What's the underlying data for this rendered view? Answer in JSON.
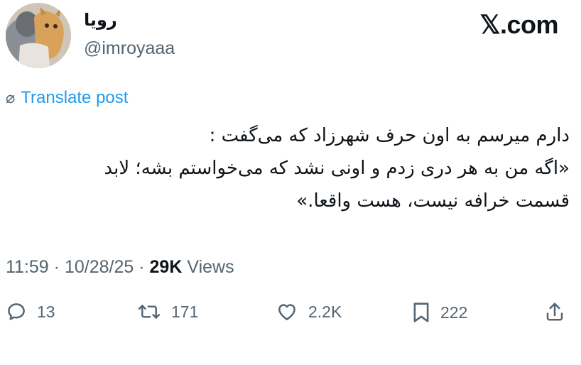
{
  "user": {
    "display_name": "رویا",
    "handle": "@imroyaaa"
  },
  "brand": "𝕏.com",
  "translate_label": "Translate post",
  "tweet": {
    "lines": [
      "دارم میرسم به اون حرف شهرزاد که می‌گفت :",
      "«اگه من به هر دری زدم و اونی نشد که می‌خواستم بشه؛ لابد",
      "قسمت خرافه نیست، هست واقعا.»"
    ]
  },
  "meta": {
    "time": "11:59",
    "date": "10/28/25",
    "views_count": "29K",
    "views_label": "Views"
  },
  "actions": {
    "replies": "13",
    "reposts": "171",
    "likes": "2.2K",
    "bookmarks": "222"
  }
}
